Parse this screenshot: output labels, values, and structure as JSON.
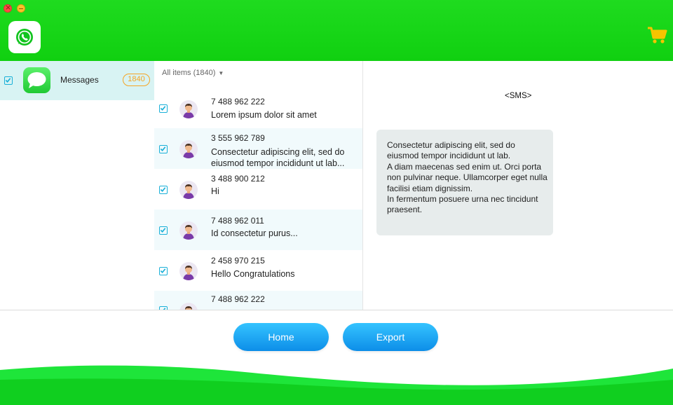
{
  "window": {
    "controls": [
      "close",
      "minimize"
    ]
  },
  "header": {
    "logo_icon": "whatsapp-icon",
    "cart_icon": "cart-icon",
    "brand_color": "#13d413",
    "cart_color": "#f5c400"
  },
  "sidebar": {
    "items": [
      {
        "label": "Messages",
        "count": "1840",
        "checked": true,
        "icon": "messages-app-icon"
      }
    ]
  },
  "list": {
    "filter_label": "All items (1840)",
    "rows": [
      {
        "number": "7 488 962 222",
        "text": "Lorem ipsum dolor sit amet",
        "checked": true
      },
      {
        "number": "3 555 962 789",
        "text": "Consectetur adipiscing elit, sed do eiusmod tempor incididunt ut lab...",
        "checked": true
      },
      {
        "number": "3 488 900 212",
        "text": "Hi",
        "checked": true
      },
      {
        "number": "7 488 962 011",
        "text": "Id consectetur purus...",
        "checked": true
      },
      {
        "number": "2 458 970 215",
        "text": "Hello Congratulations",
        "checked": true
      },
      {
        "number": "7 488 962 222",
        "text": "",
        "checked": true
      }
    ]
  },
  "detail": {
    "type_label": "<SMS>",
    "message": "Consectetur adipiscing elit, sed do eiusmod tempor incididunt ut lab.\nA diam maecenas sed enim ut. Orci porta non pulvinar neque. Ullamcorper eget nulla facilisi etiam dignissim.\nIn fermentum posuere urna nec tincidunt praesent."
  },
  "buttons": {
    "home": "Home",
    "export": "Export"
  },
  "colors": {
    "accent_blue": "#14a0f0",
    "checkbox": "#1ab0d8",
    "count_badge": "#f5a524"
  }
}
